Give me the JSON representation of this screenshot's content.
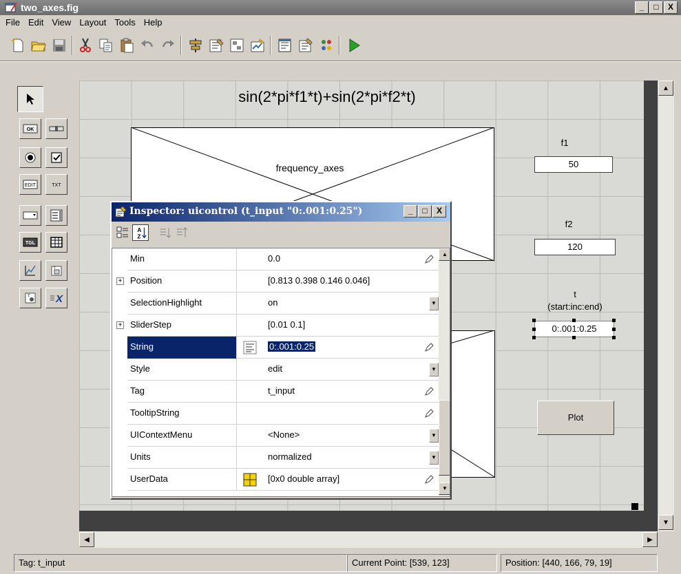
{
  "window": {
    "title": "two_axes.fig",
    "minimize": "_",
    "maximize": "□",
    "close": "X"
  },
  "menu": [
    "File",
    "Edit",
    "View",
    "Layout",
    "Tools",
    "Help"
  ],
  "figure": {
    "axes_title": "sin(2*pi*f1*t)+sin(2*pi*f2*t)",
    "frequency_axes_label": "frequency_axes",
    "f1_label": "f1",
    "f1_value": "50",
    "f2_label": "f2",
    "f2_value": "120",
    "t_label": "t",
    "t_sublabel": "(start:inc:end)",
    "t_value": "0:.001:0.25",
    "plot_button": "Plot"
  },
  "inspector": {
    "title": "Inspector:  uicontrol (t_input \"0:.001:0.25\")",
    "rows": [
      {
        "name": "Min",
        "value": "0.0"
      },
      {
        "name": "Position",
        "value": "[0.813 0.398 0.146 0.046]"
      },
      {
        "name": "SelectionHighlight",
        "value": "on"
      },
      {
        "name": "SliderStep",
        "value": "[0.01 0.1]"
      },
      {
        "name": "String",
        "value": "0:.001:0.25"
      },
      {
        "name": "Style",
        "value": "edit"
      },
      {
        "name": "Tag",
        "value": "t_input"
      },
      {
        "name": "TooltipString",
        "value": ""
      },
      {
        "name": "UIContextMenu",
        "value": "<None>"
      },
      {
        "name": "Units",
        "value": "normalized"
      },
      {
        "name": "UserData",
        "value": "[0x0  double array]"
      }
    ]
  },
  "status": {
    "tag": "Tag: t_input",
    "current_point": "Current Point:  [539, 123]",
    "position": "Position: [440, 166, 79, 19]"
  },
  "colors": {
    "selection": "#0a246a",
    "titlebar": "#808080",
    "dark_frame": "#404040"
  },
  "icons": [
    "new-file-icon",
    "open-folder-icon",
    "save-icon",
    "cut-icon",
    "copy-icon",
    "paste-icon",
    "undo-icon",
    "redo-icon",
    "align-icon",
    "menu-editor-icon",
    "tab-order-icon",
    "toolbar-editor-icon",
    "mfile-editor-icon",
    "property-inspector-icon",
    "object-browser-icon",
    "run-icon"
  ]
}
